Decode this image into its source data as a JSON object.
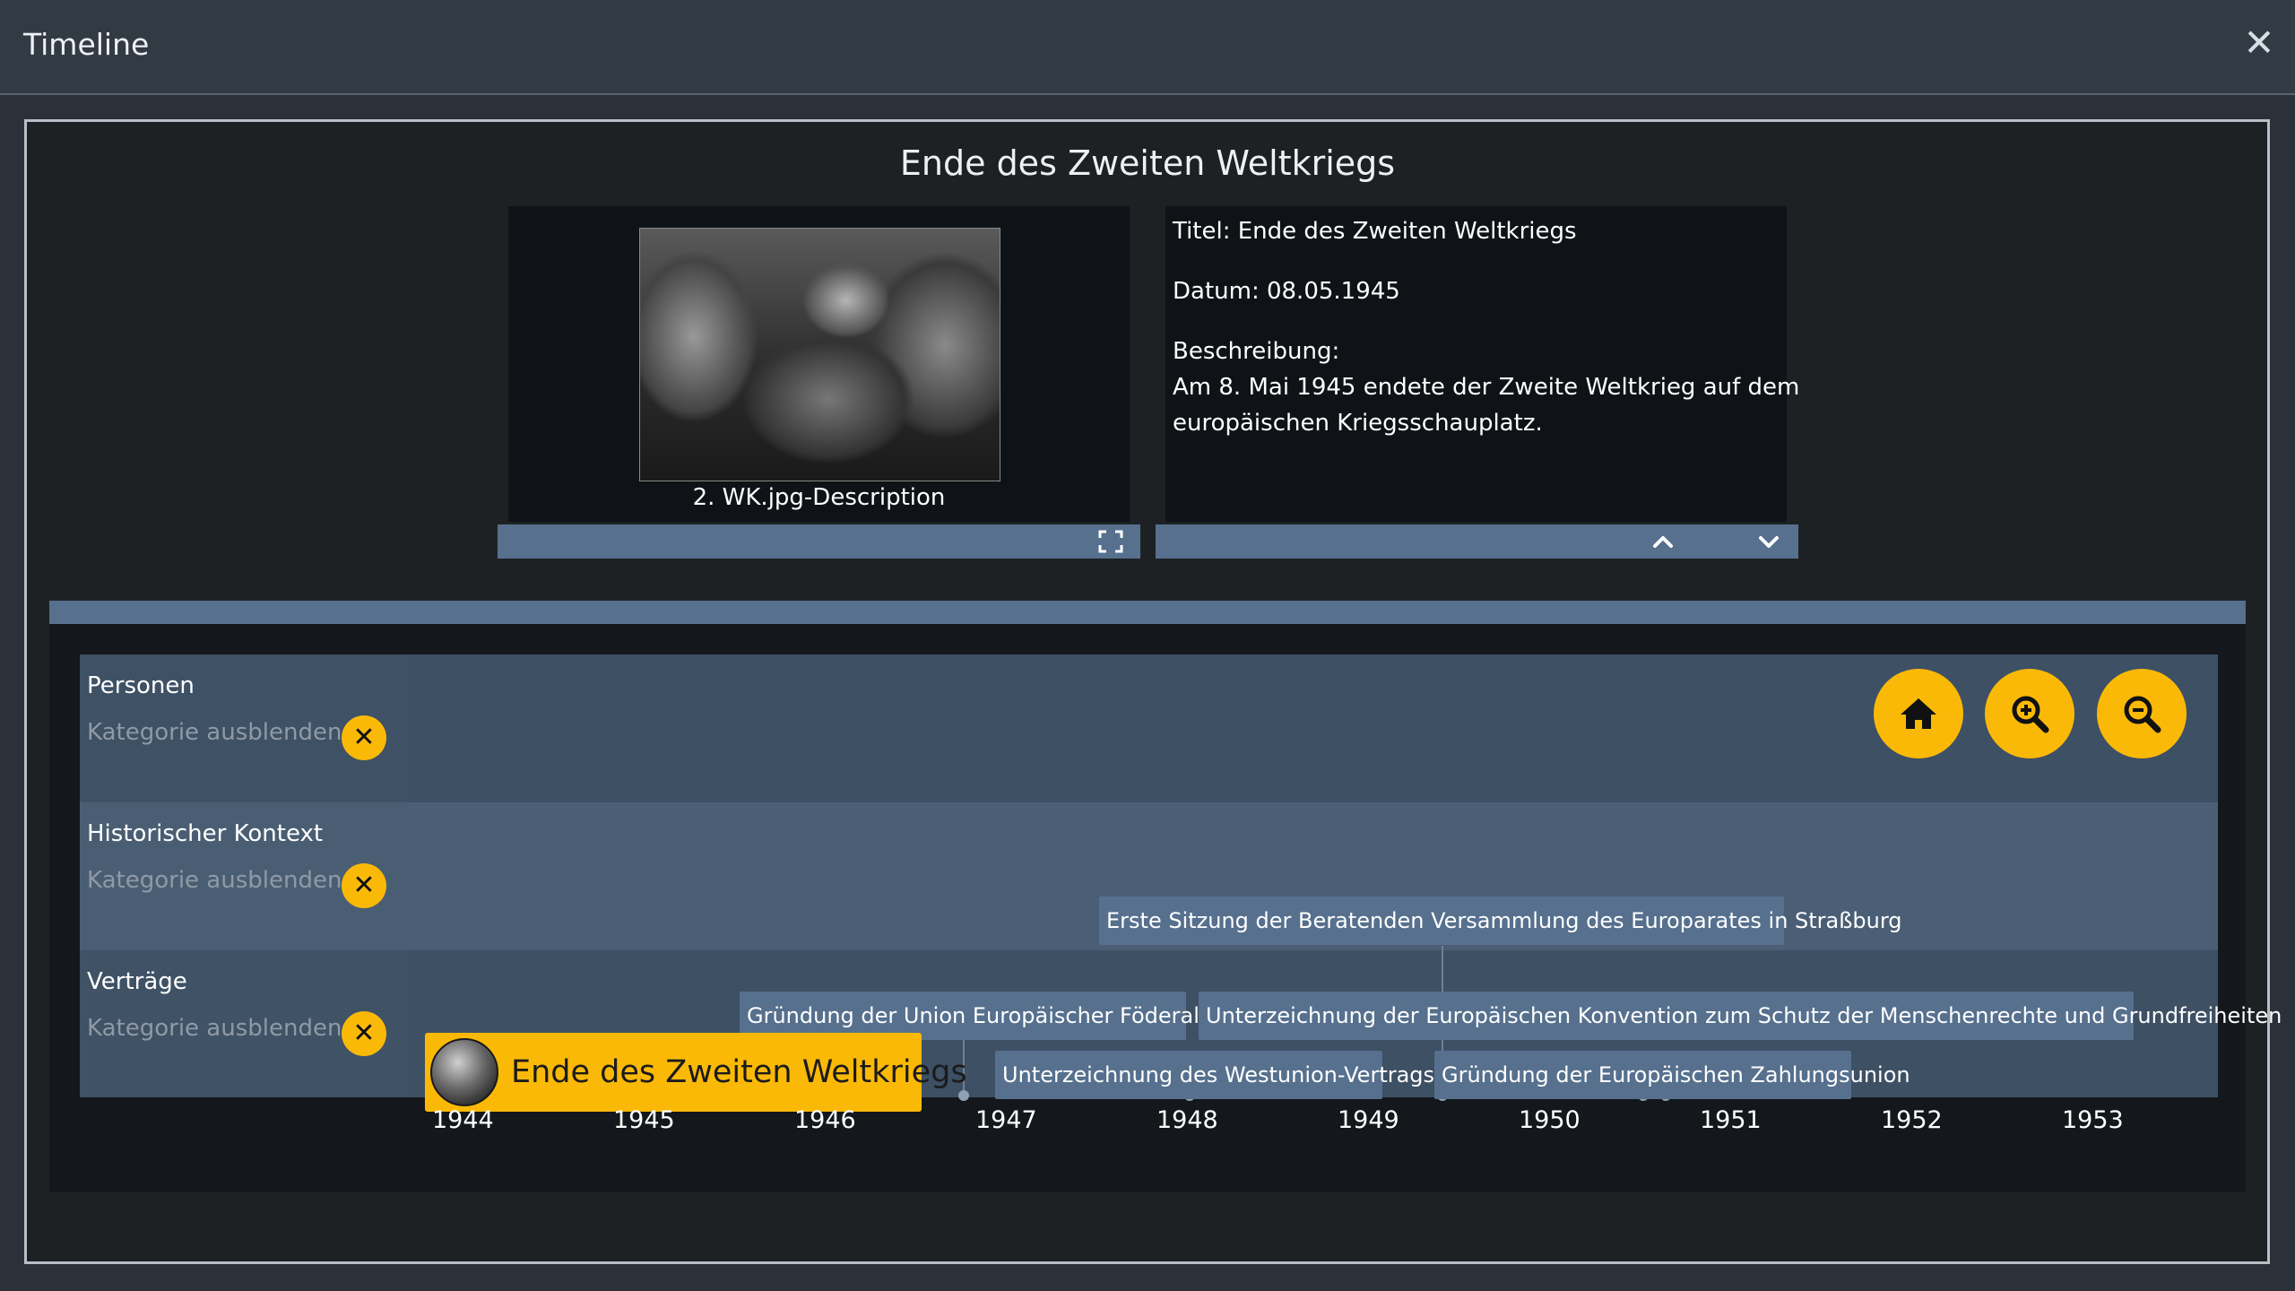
{
  "window": {
    "title": "Timeline"
  },
  "event_heading": "Ende des Zweiten Weltkriegs",
  "media": {
    "caption": "2. WK.jpg-Description"
  },
  "info": {
    "title_line": "Titel: Ende des Zweiten Weltkriegs",
    "date_line": "Datum: 08.05.1945",
    "description_label": "Beschreibung:",
    "description_line1": "Am 8. Mai 1945 endete der Zweite Weltkrieg auf dem",
    "description_line2": "europäischen Kriegsschauplatz."
  },
  "categories": [
    {
      "name": "Personen",
      "hide_label": "Kategorie ausblenden:"
    },
    {
      "name": "Historischer Kontext",
      "hide_label": "Kategorie ausblenden:"
    },
    {
      "name": "Verträge",
      "hide_label": "Kategorie ausblenden:"
    }
  ],
  "events": [
    {
      "label": "Erste Sitzung der Beratenden Versammlung des Europarates in Straßburg"
    },
    {
      "label": "Gründung der Union Europäischer Föderalisten"
    },
    {
      "label": "Unterzeichnung der Europäischen Konvention zum Schutz der Menschenrechte und Grundfreiheiten"
    },
    {
      "label": "Unterzeichnung des Westunion-Vertrags"
    },
    {
      "label": "Gründung der Europäischen Zahlungsunion"
    }
  ],
  "selected_event": {
    "label": "Ende des Zweiten Weltkriegs"
  },
  "years": [
    "1944",
    "1945",
    "1946",
    "1947",
    "1948",
    "1949",
    "1950",
    "1951",
    "1952",
    "1953"
  ],
  "colors": {
    "accent": "#fbb907",
    "bar": "#56708e"
  },
  "icons": [
    "close-icon",
    "fullscreen-icon",
    "chevron-up-icon",
    "chevron-down-icon",
    "home-icon",
    "zoom-in-icon",
    "zoom-out-icon"
  ]
}
